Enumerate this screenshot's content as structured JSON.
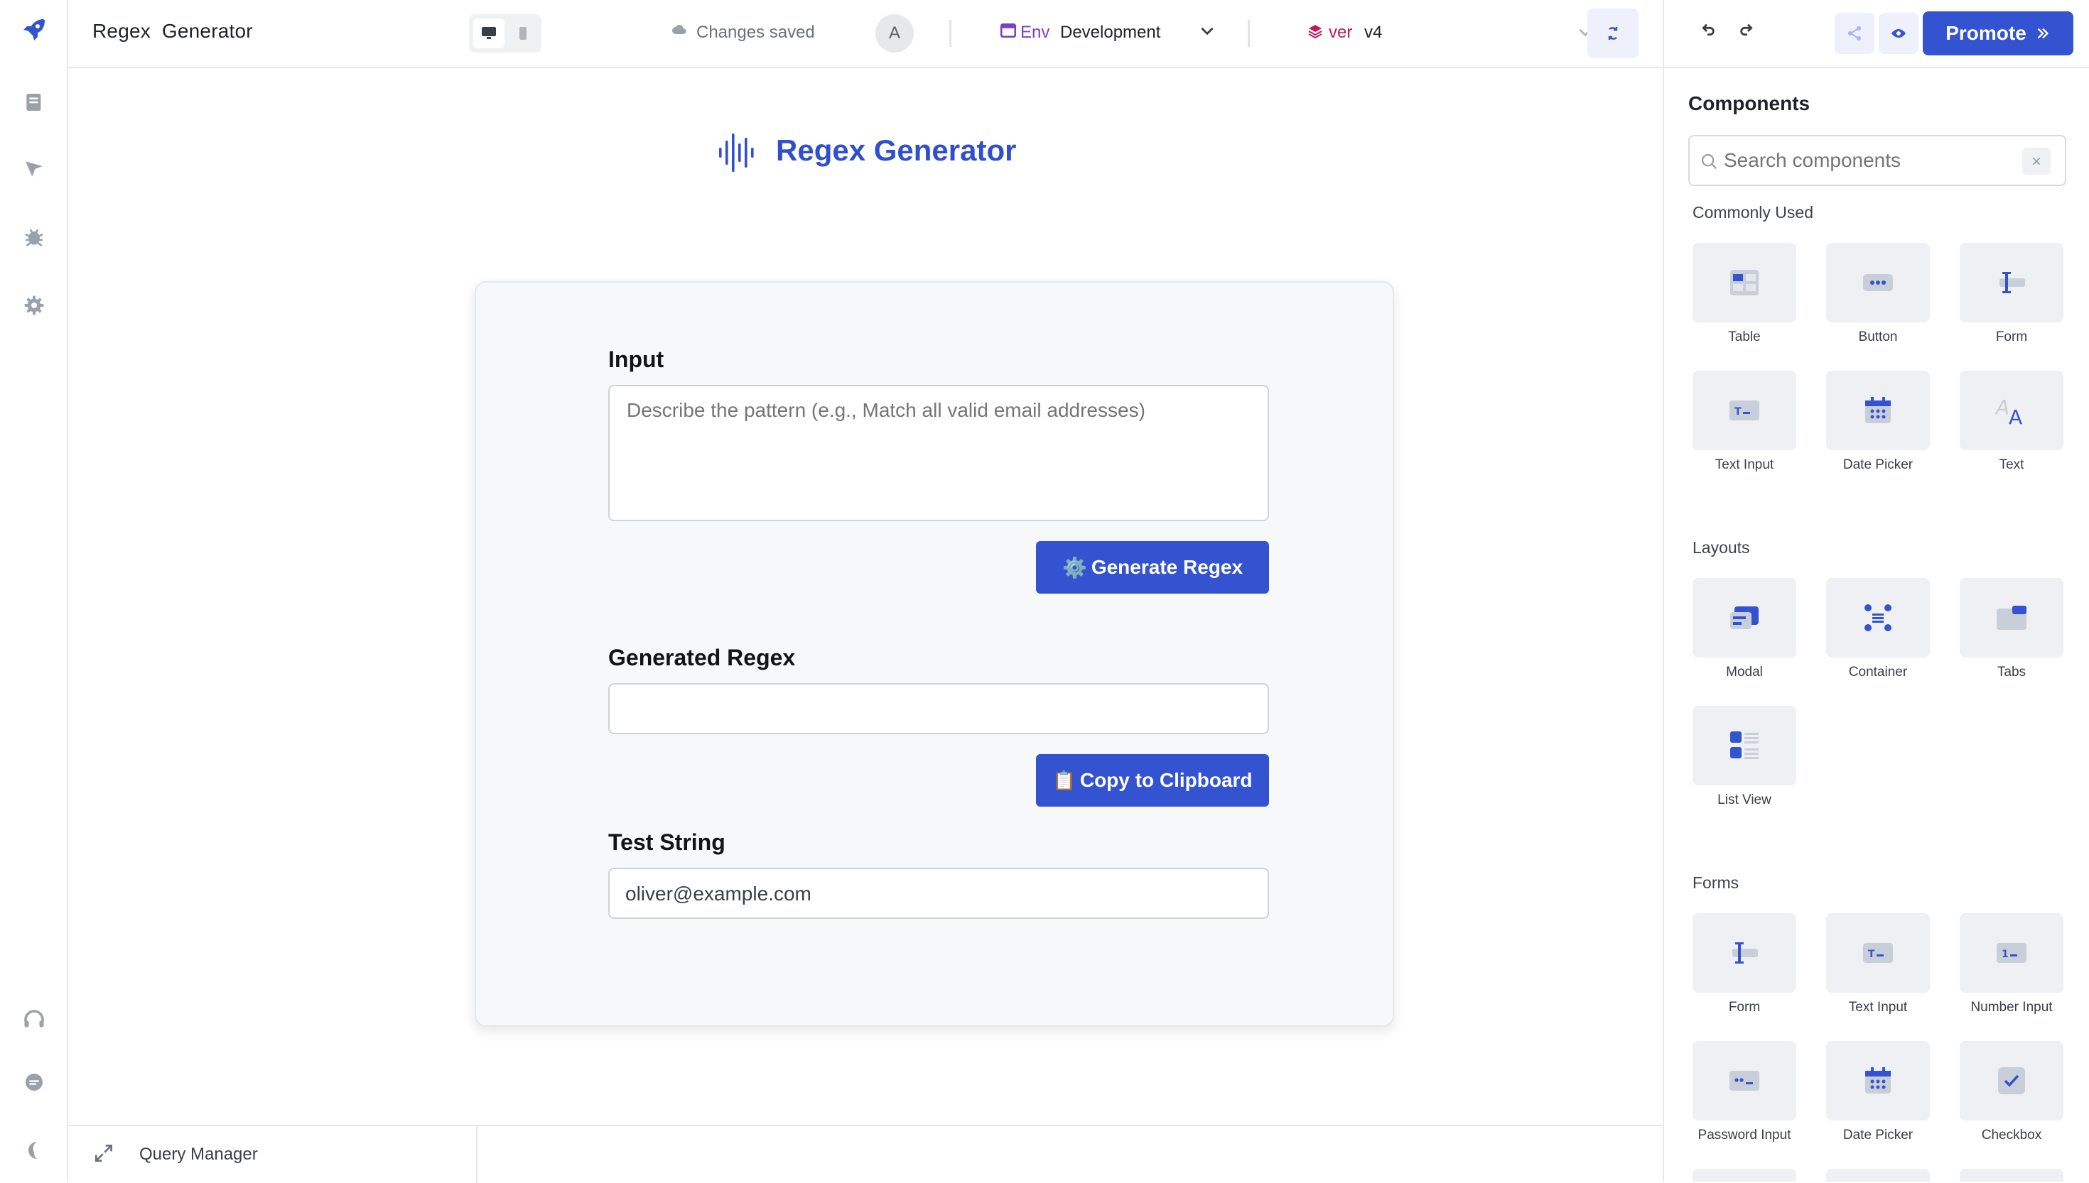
{
  "app": {
    "title": "Regex  Generator"
  },
  "topbar": {
    "save_status": "Changes saved",
    "avatar_initial": "A",
    "env_tag": "Env",
    "env_value": "Development",
    "version_tag": "ver",
    "version_value": "v4",
    "promote_label": "Promote"
  },
  "canvas": {
    "heading": "Regex Generator",
    "input_label": "Input",
    "input_placeholder": "Describe the pattern (e.g., Match all valid email addresses)",
    "generate_label": "Generate Regex",
    "generated_label": "Generated Regex",
    "generated_value": "",
    "copy_label": "Copy to Clipboard",
    "test_label": "Test String",
    "test_value": "oliver@example.com"
  },
  "bottom": {
    "query_manager": "Query Manager"
  },
  "components_panel": {
    "title": "Components",
    "search_placeholder": "Search components",
    "sections": [
      {
        "title": "Commonly Used",
        "items": [
          "Table",
          "Button",
          "Form",
          "Text Input",
          "Date Picker",
          "Text"
        ]
      },
      {
        "title": "Layouts",
        "items": [
          "Modal",
          "Container",
          "Tabs",
          "List View"
        ]
      },
      {
        "title": "Forms",
        "items": [
          "Form",
          "Text Input",
          "Number Input",
          "Password Input",
          "Date Picker",
          "Checkbox"
        ]
      }
    ]
  },
  "colors": {
    "accent": "#3453d1",
    "heading": "#2f4fcf",
    "env": "#7b3fc4",
    "version": "#c2185b"
  }
}
